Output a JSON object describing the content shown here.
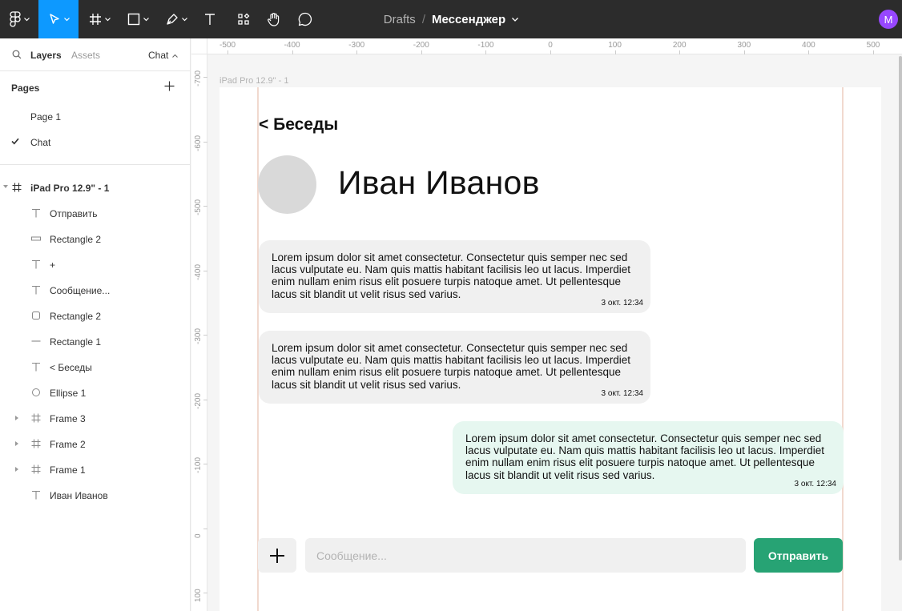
{
  "toolbar": {
    "breadcrumb_drafts": "Drafts",
    "breadcrumb_sep": "/",
    "file_name": "Мессенджер",
    "user_initial": "M",
    "user_color": "#9747ff",
    "active_color": "#0d99ff"
  },
  "sidebar": {
    "tabs": {
      "layers": "Layers",
      "assets": "Assets"
    },
    "current_page": "Chat",
    "pages_title": "Pages",
    "pages": [
      {
        "label": "Page 1",
        "selected": false
      },
      {
        "label": "Chat",
        "selected": true
      }
    ],
    "root_layer": "iPad Pro 12.9\" - 1",
    "layers": [
      {
        "label": "Отправить",
        "icon": "text-icon"
      },
      {
        "label": "Rectangle 2",
        "icon": "rectangle-thin-icon"
      },
      {
        "label": "+",
        "icon": "text-icon"
      },
      {
        "label": "Сообщение...",
        "icon": "text-icon"
      },
      {
        "label": "Rectangle 2",
        "icon": "rectangle-icon"
      },
      {
        "label": "Rectangle 1",
        "icon": "line-icon"
      },
      {
        "label": "< Беседы",
        "icon": "text-icon"
      },
      {
        "label": "Ellipse 1",
        "icon": "ellipse-icon"
      },
      {
        "label": "Frame 3",
        "icon": "frame-icon"
      },
      {
        "label": "Frame 2",
        "icon": "frame-icon"
      },
      {
        "label": "Frame 1",
        "icon": "frame-icon"
      },
      {
        "label": "Иван Иванов",
        "icon": "text-icon"
      }
    ]
  },
  "canvas": {
    "ruler_top": [
      "-500",
      "-400",
      "-300",
      "-200",
      "-100",
      "0",
      "100",
      "200",
      "300",
      "400",
      "500"
    ],
    "ruler_left": [
      "-700",
      "-600",
      "-500",
      "-400",
      "-300",
      "-200",
      "-100",
      "0",
      "100"
    ],
    "frame_label": "iPad Pro 12.9\" - 1"
  },
  "chat": {
    "back_label": "< Беседы",
    "contact_name": "Иван Иванов",
    "messages": [
      {
        "text": "Lorem ipsum dolor sit amet consectetur. Consectetur quis semper nec sed lacus vulputate eu. Nam quis mattis habitant facilisis leo ut lacus. Imperdiet enim nullam enim risus elit posuere turpis natoque amet. Ut pellentesque lacus sit blandit ut velit risus sed varius.",
        "time": "3 окт. 12:34",
        "direction": "incoming"
      },
      {
        "text": "Lorem ipsum dolor sit amet consectetur. Consectetur quis semper nec sed lacus vulputate eu. Nam quis mattis habitant facilisis leo ut lacus. Imperdiet enim nullam enim risus elit posuere turpis natoque amet. Ut pellentesque lacus sit blandit ut velit risus sed varius.",
        "time": "3 окт. 12:34",
        "direction": "incoming"
      },
      {
        "text": "Lorem ipsum dolor sit amet consectetur. Consectetur quis semper nec sed lacus vulputate eu. Nam quis mattis habitant facilisis leo ut lacus. Imperdiet enim nullam enim risus elit posuere turpis natoque amet. Ut pellentesque lacus sit blandit ut velit risus sed varius.",
        "time": "3 окт. 12:34",
        "direction": "outgoing"
      }
    ],
    "plus_label": "+",
    "input_placeholder": "Сообщение...",
    "send_label": "Отправить",
    "send_color": "#27a374",
    "incoming_color": "#f0f0f0",
    "outgoing_color": "#e6f7f0"
  }
}
